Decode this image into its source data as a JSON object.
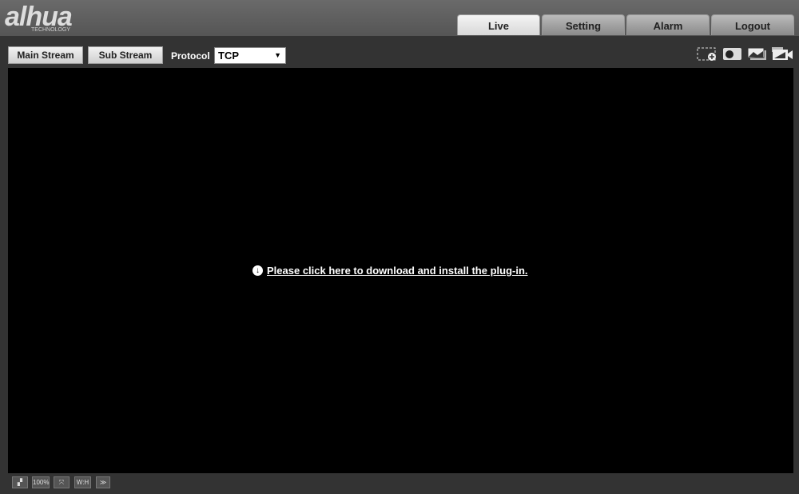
{
  "header": {
    "logo": "alhua",
    "logo_sub": "TECHNOLOGY",
    "tabs": [
      {
        "label": "Live",
        "active": true
      },
      {
        "label": "Setting"
      },
      {
        "label": "Alarm"
      },
      {
        "label": "Logout"
      }
    ]
  },
  "toolbar": {
    "main_stream": "Main Stream",
    "sub_stream": "Sub Stream",
    "protocol_label": "Protocol",
    "protocol_value": "TCP",
    "icons": [
      "zoom-region-icon",
      "snapshot-icon",
      "triple-snapshot-icon",
      "record-icon"
    ]
  },
  "video": {
    "plugin_text": "Please click here to download and install the plug-in."
  },
  "bottom": {
    "zoom_label": "100%",
    "ratio_label": "W:H",
    "icons": [
      "image-adjust-icon",
      "original-size-icon",
      "fullscreen-icon",
      "aspect-ratio-icon",
      "fluency-icon"
    ]
  }
}
